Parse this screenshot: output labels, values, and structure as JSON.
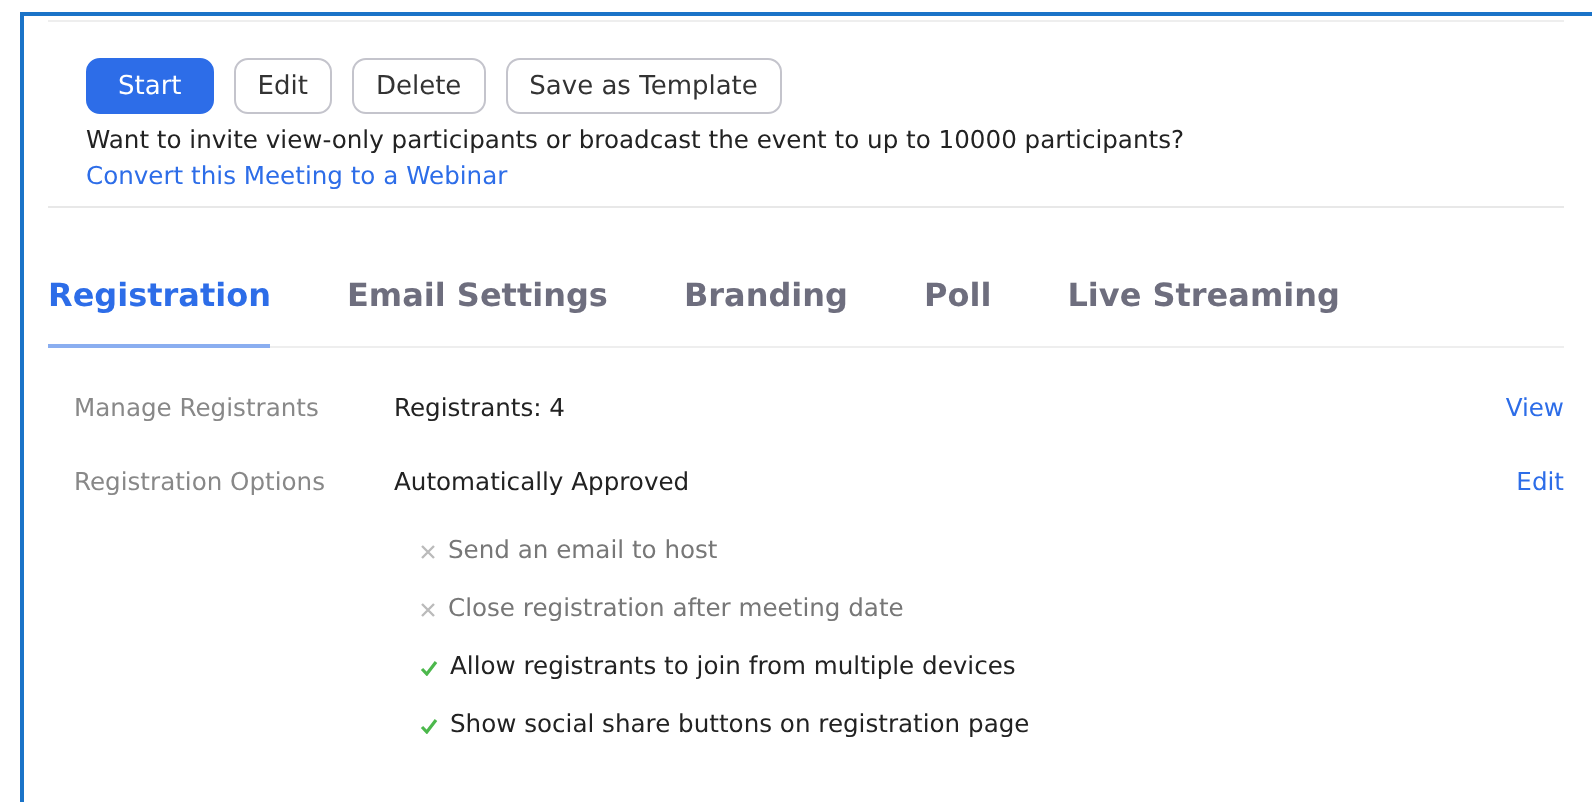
{
  "actions": [
    {
      "label": "Start",
      "kind": "primary"
    },
    {
      "label": "Edit",
      "kind": "secondary"
    },
    {
      "label": "Delete",
      "kind": "secondary"
    },
    {
      "label": "Save as Template",
      "kind": "secondary"
    }
  ],
  "webinar_notice": {
    "text": "Want to invite view-only participants or broadcast the event to up to 10000 participants?",
    "link": "Convert this Meeting to a Webinar"
  },
  "tabs": [
    {
      "label": "Registration",
      "selected": true
    },
    {
      "label": "Email Settings",
      "selected": false
    },
    {
      "label": "Branding",
      "selected": false
    },
    {
      "label": "Poll",
      "selected": false
    },
    {
      "label": "Live Streaming",
      "selected": false
    }
  ],
  "settings": [
    {
      "label": "Manage Registrants",
      "value": "Registrants: 4",
      "action": "View"
    },
    {
      "label": "Registration Options",
      "value": "Automatically Approved",
      "action": "Edit"
    }
  ],
  "options": [
    {
      "label": "Send an email to host",
      "checked": false
    },
    {
      "label": "Close registration after meeting date",
      "checked": false
    },
    {
      "label": "Allow registrants to join from multiple devices",
      "checked": true
    },
    {
      "label": "Show social share buttons on registration page",
      "checked": true
    }
  ]
}
